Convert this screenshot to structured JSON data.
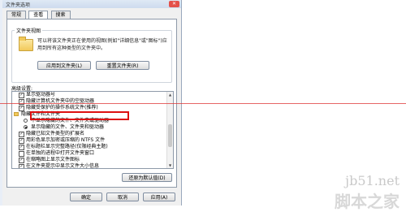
{
  "dialog": {
    "title": "文件夹选项",
    "tabs": [
      "常规",
      "查看",
      "搜索"
    ],
    "active_tab": "查看",
    "folder_views": {
      "title": "文件夹视图",
      "description": "可以将该文件夹正在使用的视图(例如\"详细信息\"或\"图标\")应用到所有这种类型的文件夹中。",
      "apply_button": "应用到文件夹(L)",
      "reset_button": "重置文件夹(R)"
    },
    "advanced": {
      "label": "高级设置:",
      "items": [
        {
          "kind": "checkbox",
          "checked": true,
          "indent": 1,
          "text": "显示驱动器号"
        },
        {
          "kind": "checkbox",
          "checked": true,
          "indent": 1,
          "text": "隐藏计算机文件夹中的空驱动器"
        },
        {
          "kind": "checkbox",
          "checked": true,
          "indent": 1,
          "text": "隐藏受保护的操作系统文件(推荐)"
        },
        {
          "kind": "folder",
          "indent": 0,
          "text": "隐藏文件和文件夹"
        },
        {
          "kind": "radio",
          "checked": false,
          "indent": 2,
          "text": "不显示隐藏的文件、文件夹或驱动器"
        },
        {
          "kind": "radio",
          "checked": true,
          "indent": 2,
          "text": "显示隐藏的文件、文件夹和驱动器"
        },
        {
          "kind": "checkbox",
          "checked": true,
          "indent": 1,
          "text": "隐藏已知文件类型的扩展名"
        },
        {
          "kind": "checkbox",
          "checked": true,
          "indent": 1,
          "text": "用彩色显示加密或压缩的 NTFS 文件"
        },
        {
          "kind": "checkbox",
          "checked": true,
          "indent": 1,
          "text": "在标题栏显示完整路径(仅限经典主题)"
        },
        {
          "kind": "checkbox",
          "checked": false,
          "indent": 1,
          "text": "在单独的进程中打开文件夹窗口"
        },
        {
          "kind": "checkbox",
          "checked": true,
          "indent": 1,
          "text": "在缩略图上显示文件图标"
        },
        {
          "kind": "checkbox",
          "checked": true,
          "indent": 1,
          "text": "在文件夹提示中显示文件大小信息"
        },
        {
          "kind": "checkbox",
          "checked": true,
          "indent": 1,
          "text": "在预览窗格中显示预览句柄"
        }
      ],
      "restore_button": "还原为默认值(D)"
    },
    "buttons": {
      "ok": "确定",
      "cancel": "取消",
      "apply": "应用(A)"
    },
    "close_glyph": "✕"
  },
  "watermark": {
    "site": "jb51.net",
    "name": "脚本之家"
  },
  "colors": {
    "highlight": "#d11111",
    "annotation_line": "#dd3333"
  },
  "icons": [
    "close-icon",
    "folder-icon",
    "scroll-up-icon",
    "scroll-down-icon"
  ]
}
